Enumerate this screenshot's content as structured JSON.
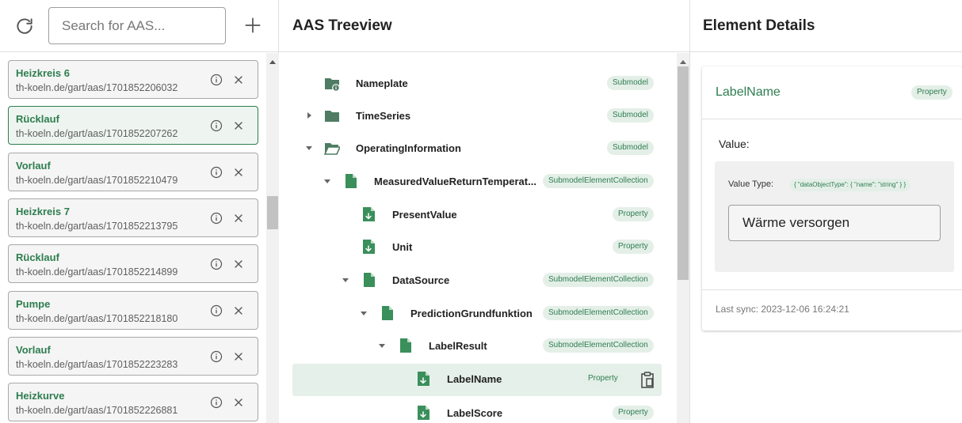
{
  "left": {
    "search_placeholder": "Search for AAS...",
    "items": [
      {
        "name": "Heizkreis 6",
        "id": "th-koeln.de/gart/aas/1701852206032",
        "selected": false
      },
      {
        "name": "Rücklauf",
        "id": "th-koeln.de/gart/aas/1701852207262",
        "selected": true
      },
      {
        "name": "Vorlauf",
        "id": "th-koeln.de/gart/aas/1701852210479",
        "selected": false
      },
      {
        "name": "Heizkreis 7",
        "id": "th-koeln.de/gart/aas/1701852213795",
        "selected": false
      },
      {
        "name": "Rücklauf",
        "id": "th-koeln.de/gart/aas/1701852214899",
        "selected": false
      },
      {
        "name": "Pumpe",
        "id": "th-koeln.de/gart/aas/1701852218180",
        "selected": false
      },
      {
        "name": "Vorlauf",
        "id": "th-koeln.de/gart/aas/1701852223283",
        "selected": false
      },
      {
        "name": "Heizkurve",
        "id": "th-koeln.de/gart/aas/1701852226881",
        "selected": false
      }
    ]
  },
  "treeview": {
    "title": "AAS Treeview",
    "nodes": [
      {
        "label": "Nameplate",
        "type": "Submodel",
        "icon": "submodel-info-icon",
        "caret": "none"
      },
      {
        "label": "TimeSeries",
        "type": "Submodel",
        "icon": "folder-icon",
        "caret": "right"
      },
      {
        "label": "OperatingInformation",
        "type": "Submodel",
        "icon": "folder-open-icon",
        "caret": "down"
      },
      {
        "label": "MeasuredValueReturnTemperat...",
        "type": "SubmodelElementCollection",
        "icon": "file-icon",
        "caret": "down"
      },
      {
        "label": "PresentValue",
        "type": "Property",
        "icon": "property-icon",
        "caret": "none"
      },
      {
        "label": "Unit",
        "type": "Property",
        "icon": "property-icon",
        "caret": "none"
      },
      {
        "label": "DataSource",
        "type": "SubmodelElementCollection",
        "icon": "file-icon",
        "caret": "down"
      },
      {
        "label": "PredictionGrundfunktion",
        "type": "SubmodelElementCollection",
        "icon": "file-icon",
        "caret": "down"
      },
      {
        "label": "LabelResult",
        "type": "SubmodelElementCollection",
        "icon": "file-icon",
        "caret": "down"
      },
      {
        "label": "LabelName",
        "type": "Property",
        "icon": "property-icon",
        "caret": "none",
        "selected": true
      },
      {
        "label": "LabelScore",
        "type": "Property",
        "icon": "property-icon",
        "caret": "none"
      }
    ]
  },
  "details": {
    "title": "Element Details",
    "element_name": "LabelName",
    "element_type": "Property",
    "value_label": "Value:",
    "value_type_label": "Value Type:",
    "value_type": "{ \"dataObjectType\": { \"name\": \"string\" } }",
    "value": "Wärme versorgen",
    "last_sync": "Last sync: 2023-12-06 16:24:21"
  },
  "colors": {
    "accent": "#2e7d4f",
    "chip_bg": "#e4efe8",
    "selected_bg": "#e6f0ea",
    "folder": "#4f7c63"
  }
}
